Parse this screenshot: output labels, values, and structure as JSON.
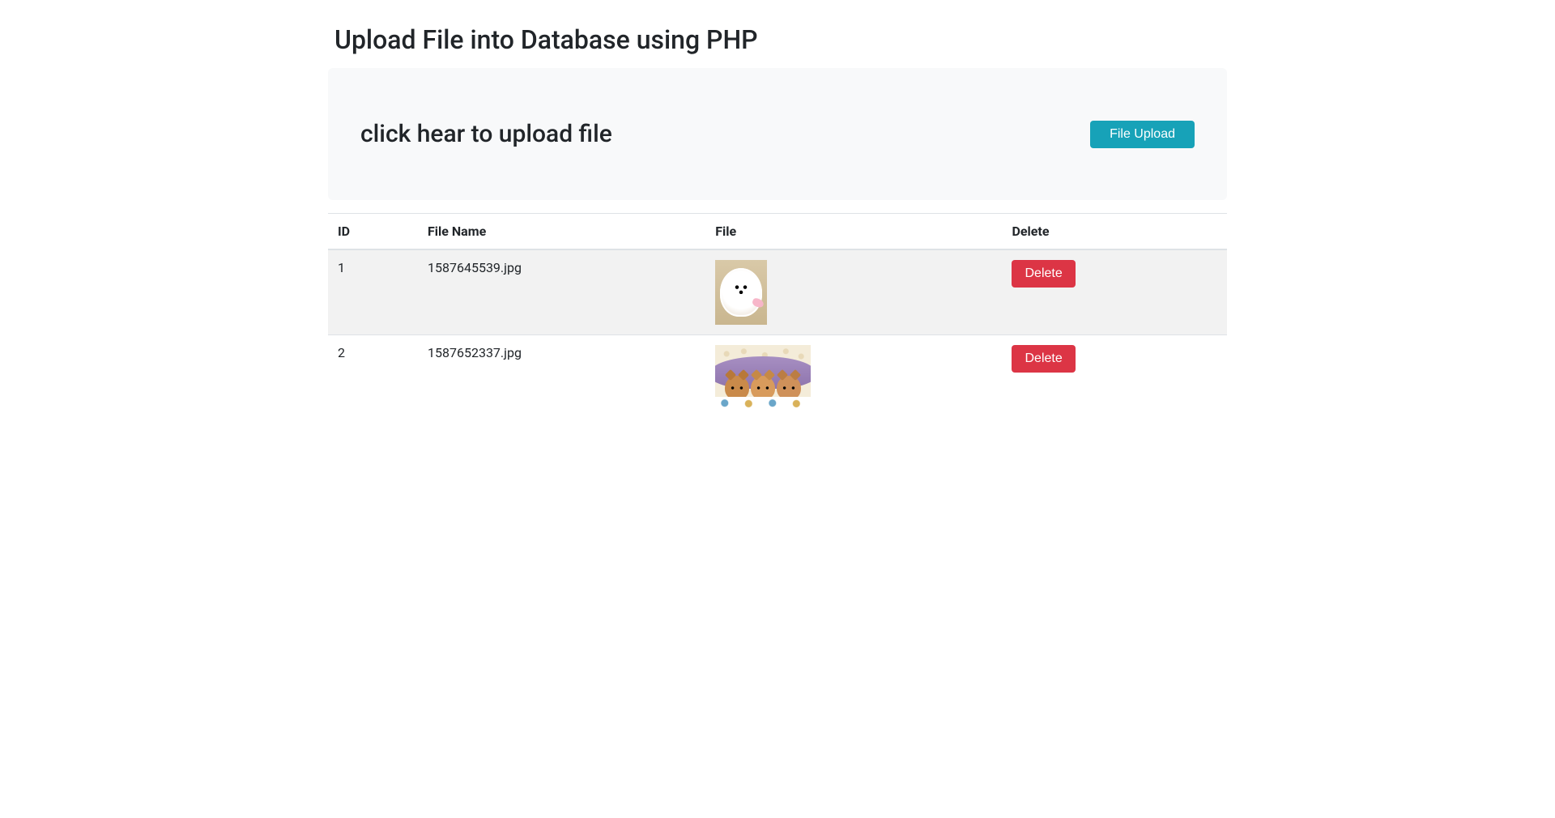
{
  "page": {
    "title": "Upload File into Database using PHP"
  },
  "uploadPanel": {
    "prompt": "click hear to upload file",
    "buttonLabel": "File Upload"
  },
  "table": {
    "headers": {
      "id": "ID",
      "fileName": "File Name",
      "file": "File",
      "delete": "Delete"
    },
    "rows": [
      {
        "id": "1",
        "fileName": "1587645539.jpg",
        "thumbKind": "puppy",
        "deleteLabel": "Delete"
      },
      {
        "id": "2",
        "fileName": "1587652337.jpg",
        "thumbKind": "kittens",
        "deleteLabel": "Delete"
      }
    ]
  }
}
